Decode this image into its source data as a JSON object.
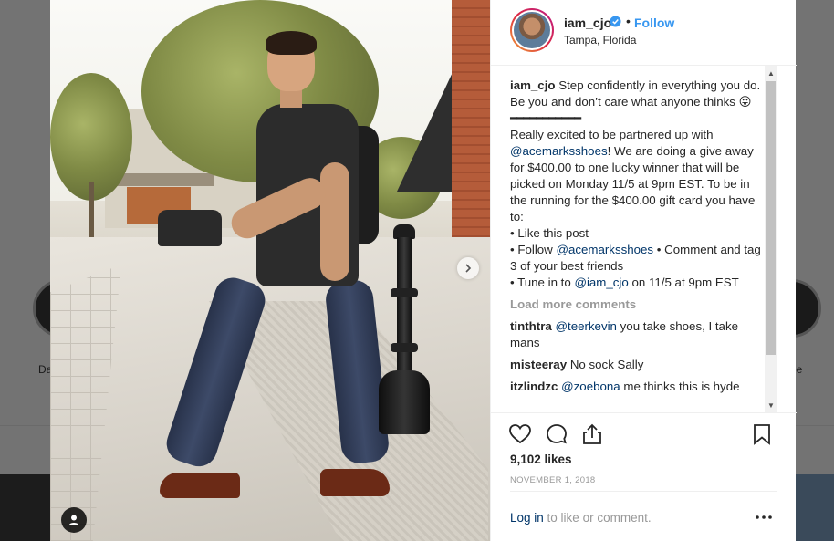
{
  "post": {
    "username": "iam_cjo",
    "separator": "•",
    "follow_label": "Follow",
    "location": "Tampa, Florida",
    "caption": {
      "user": "iam_cjo",
      "line1": "Step confidently in everything you do. Be you and don’t care what anyone thinks⁣⁣ 😛",
      "dashes": "━━━━━━━━━━━",
      "p2_a": "Really excited to be partnered up with ",
      "p2_mention": "@acemarksshoes",
      "p2_b": "! We are doing a give away for $400.00 to one lucky winner that will be picked on Monday 11/5 at 9pm EST. To be in the running for the $400.00 gift card you have to:",
      "bullet1": "• Like this post",
      "bullet2_a": "• Follow ",
      "bullet2_mention": "@acemarksshoes",
      "bullet2_b": " • Comment and tag 3 of your best friends",
      "bullet3_a": "• Tune in to ",
      "bullet3_mention": "@iam_cjo",
      "bullet3_b": " on 11/5 at 9pm EST"
    },
    "load_more": "Load more comments",
    "comments": [
      {
        "user": "tinthtra",
        "mention": "@teerkevin",
        "text": " you take shoes, I take mans"
      },
      {
        "user": "misteeray",
        "mention": "",
        "text": "No sock Sally"
      },
      {
        "user": "itzlindzc",
        "mention": "@zoebona",
        "text": " me thinks this is hyde"
      }
    ],
    "likes": "9,102 likes",
    "date": "NOVEMBER 1, 2018",
    "login_link": "Log in",
    "login_suffix": " to like or comment."
  },
  "background": {
    "label_left": "Da",
    "label_right": "be"
  },
  "icons": {
    "like": "heart-icon",
    "comment": "comment-icon",
    "share": "share-icon",
    "save": "bookmark-icon",
    "more": "more-options-icon",
    "next": "chevron-right-icon",
    "tag": "user-tag-icon",
    "verified": "verified-badge-icon"
  },
  "colors": {
    "follow": "#3897f0",
    "mention": "#003569",
    "muted": "#999999",
    "verified": "#3897f0"
  }
}
